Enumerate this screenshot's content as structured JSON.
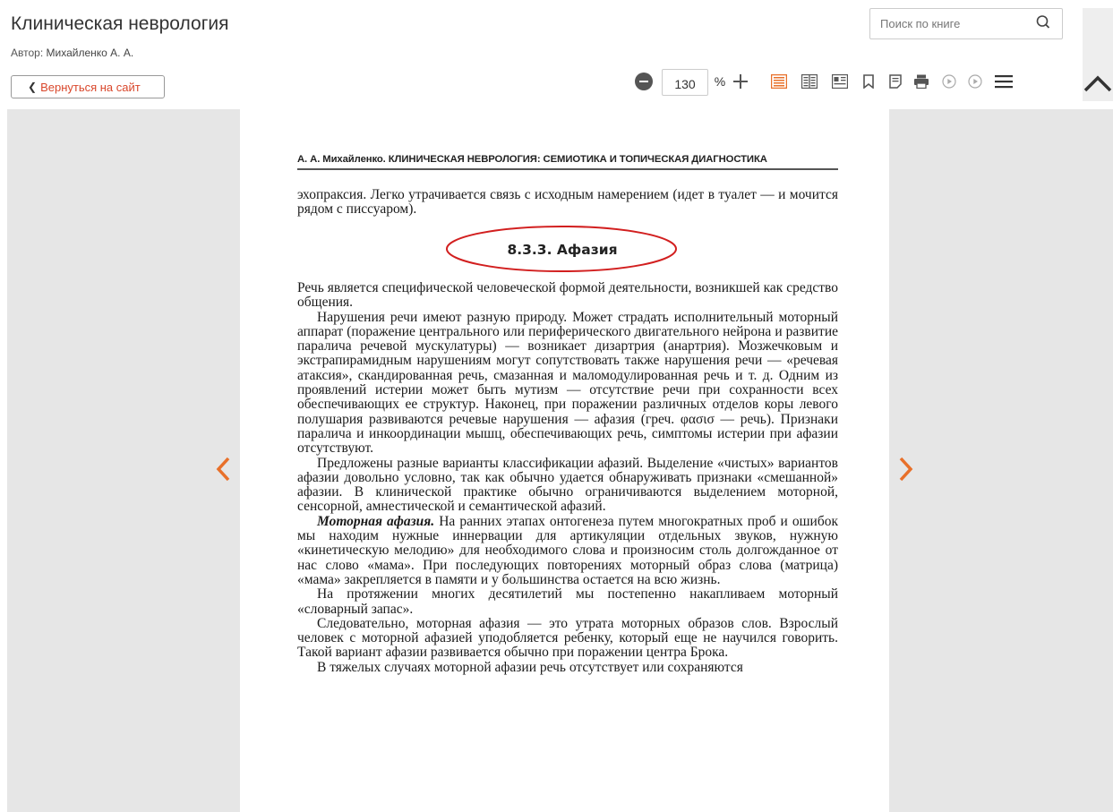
{
  "header": {
    "book_title": "Клиническая неврология",
    "author_label": "Автор:",
    "author_name": "Михайленко А. А.",
    "back_button": "Вернуться на сайт"
  },
  "search": {
    "placeholder": "Поиск по книге",
    "icon": "search-icon"
  },
  "toolbar": {
    "zoom_value": "130",
    "zoom_unit": "%",
    "icons": [
      "zoom-out-icon",
      "zoom-in-icon",
      "single-page-icon",
      "two-page-icon",
      "text-view-icon",
      "bookmark-icon",
      "notes-icon",
      "print-icon",
      "play-icon",
      "play-all-icon",
      "menu-icon"
    ],
    "accent_color": "#e8702a"
  },
  "page": {
    "running_head": "А. А. Михайленко. КЛИНИЧЕСКАЯ НЕВРОЛОГИЯ: СЕМИОТИКА И ТОПИЧЕСКАЯ ДИАГНОСТИКА",
    "intro_paragraph": "эхопраксия. Легко утрачивается связь с исходным намерением (идет в туалет — и мочится рядом с писсуаром).",
    "section_heading": "8.3.3. Афазия",
    "paragraphs": [
      "Речь является специфической человеческой формой деятельности, возникшей как средство общения.",
      "Нарушения речи имеют разную природу. Может страдать исполнительный моторный аппарат (поражение центрального или периферического двигательного нейрона и развитие паралича речевой мускулатуры) — возникает дизартрия (анартрия). Мозжечковым и экстрапирамидным нарушениям могут сопутствовать также нарушения речи — «речевая атаксия», скандированная речь, смазанная и маломодулированная речь и т. д. Одним из проявлений истерии может быть мутизм — отсутствие речи при сохранности всех обеспечивающих ее структур. Наконец, при поражении различных отделов коры левого полушария развиваются речевые нарушения — афазия (греч. φασισ — речь). Признаки паралича и инкоординации мышц, обеспечивающих речь, симптомы истерии при афазии отсутствуют.",
      "Предложены разные варианты классификации афазий. Выделение «чистых» вариантов афазии довольно условно, так как обычно удается обнаруживать признаки «смешанной» афазии. В клинической практике обычно ограничиваются выделением моторной, сенсорной, амнестической и семантической афазий."
    ],
    "motor_term": "Моторная афазия.",
    "motor_paragraph": " На ранних этапах онтогенеза путем многократных проб и ошибок мы находим нужные иннервации для артикуляции отдельных звуков, нужную «кинетическую мелодию» для необходимого слова и произносим столь долгожданное от нас слово «мама». При последующих повторениях моторный образ слова (матрица) «мама» закрепляется в памяти и у большинства остается на всю жизнь.",
    "paragraphs_after": [
      "На протяжении многих десятилетий мы постепенно накапливаем моторный «словарный запас».",
      "Следовательно, моторная афазия — это утрата моторных образов слов. Взрослый человек с моторной афазией уподобляется ребенку, который еще не научился говорить. Такой вариант афазии развивается обычно при поражении центра Брока.",
      "В тяжелых случаях моторной афазии речь отсутствует или сохраняются"
    ]
  }
}
